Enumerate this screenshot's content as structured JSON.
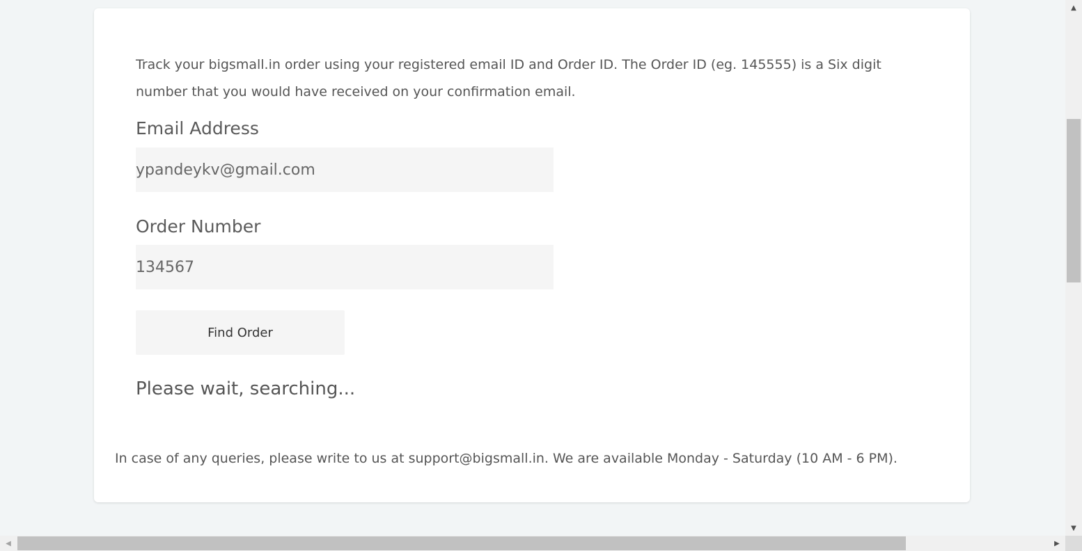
{
  "tracker": {
    "intro_text": "Track your bigsmall.in order using your registered email ID and Order ID. The Order ID (eg. 145555) is a Six digit number that you would have received on your confirmation email.",
    "email_label": "Email Address",
    "email_value": "ypandeykv@gmail.com",
    "order_label": "Order Number",
    "order_value": "134567",
    "find_button_label": "Find Order",
    "status_text": "Please wait, searching...",
    "support_text": "In case of any queries, please write to us at support@bigsmall.in. We are available Monday - Saturday (10 AM - 6 PM)."
  },
  "scrollbars": {
    "up_arrow": "▲",
    "down_arrow": "▼",
    "left_arrow": "◀",
    "right_arrow": "▶"
  },
  "colors": {
    "page_background": "#f2f5f6",
    "card_background": "#ffffff",
    "input_background": "#f5f5f5",
    "text": "#555555"
  }
}
